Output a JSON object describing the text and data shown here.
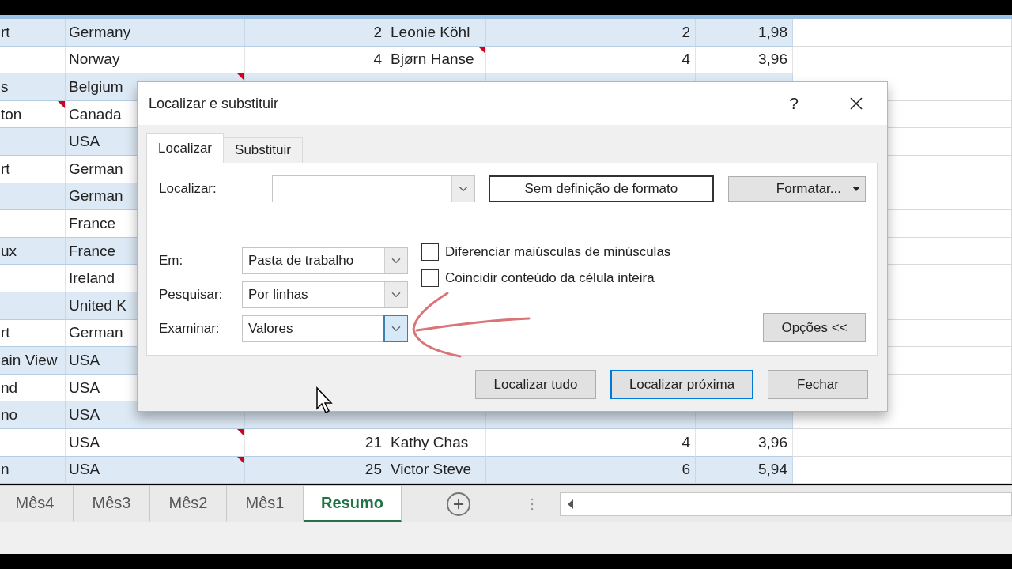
{
  "sheet": {
    "rows": [
      {
        "cells": [
          {
            "text": "rt"
          },
          {
            "text": "Germany"
          },
          {
            "text": "2"
          },
          {
            "text": "Leonie Köhl"
          },
          {
            "text": "2"
          },
          {
            "text": "1,98"
          }
        ]
      },
      {
        "cells": [
          {},
          {
            "text": "Norway"
          },
          {
            "text": "4"
          },
          {
            "text": "Bjørn Hanse",
            "note": true
          },
          {
            "text": "4"
          },
          {
            "text": "3,96"
          }
        ]
      },
      {
        "cells": [
          {
            "text": "s"
          },
          {
            "text": "Belgium",
            "note": true
          },
          {},
          {},
          {},
          {}
        ]
      },
      {
        "cells": [
          {
            "text": "ton",
            "note": true
          },
          {
            "text": "Canada"
          },
          {},
          {},
          {},
          {}
        ]
      },
      {
        "cells": [
          {},
          {
            "text": "USA"
          },
          {},
          {},
          {},
          {}
        ]
      },
      {
        "cells": [
          {
            "text": "rt"
          },
          {
            "text": "German"
          },
          {},
          {},
          {},
          {}
        ]
      },
      {
        "cells": [
          {},
          {
            "text": "German"
          },
          {},
          {},
          {},
          {}
        ]
      },
      {
        "cells": [
          {},
          {
            "text": "France"
          },
          {},
          {},
          {},
          {}
        ]
      },
      {
        "cells": [
          {
            "text": "ux"
          },
          {
            "text": "France"
          },
          {},
          {},
          {},
          {}
        ]
      },
      {
        "cells": [
          {},
          {
            "text": "Ireland"
          },
          {},
          {},
          {},
          {}
        ]
      },
      {
        "cells": [
          {},
          {
            "text": "United K"
          },
          {},
          {},
          {},
          {}
        ]
      },
      {
        "cells": [
          {
            "text": "rt"
          },
          {
            "text": "German"
          },
          {},
          {},
          {},
          {}
        ]
      },
      {
        "cells": [
          {
            "text": "ain View"
          },
          {
            "text": "USA"
          },
          {},
          {},
          {},
          {}
        ]
      },
      {
        "cells": [
          {
            "text": "nd"
          },
          {
            "text": "USA"
          },
          {},
          {},
          {},
          {}
        ]
      },
      {
        "cells": [
          {
            "text": "no"
          },
          {
            "text": "USA"
          },
          {},
          {},
          {},
          {}
        ]
      },
      {
        "cells": [
          {},
          {
            "text": "USA",
            "note": true
          },
          {
            "text": "21"
          },
          {
            "text": "Kathy Chas"
          },
          {
            "text": "4"
          },
          {
            "text": "3,96"
          }
        ]
      },
      {
        "cells": [
          {
            "text": "n"
          },
          {
            "text": "USA",
            "note": true
          },
          {
            "text": "25"
          },
          {
            "text": "Victor Steve"
          },
          {
            "text": "6"
          },
          {
            "text": "5,94"
          }
        ]
      }
    ]
  },
  "dialog": {
    "title": "Localizar e substituir",
    "help_button": "?",
    "tabs": [
      {
        "label": "Localizar",
        "selected": true
      },
      {
        "label": "Substituir",
        "selected": false
      }
    ],
    "find": {
      "label": "Localizar:"
    },
    "format_preview": "Sem definição de formato",
    "format_button": "Formatar...",
    "options": [
      {
        "label": "Em:",
        "value": "Pasta de trabalho",
        "focused": false
      },
      {
        "label": "Pesquisar:",
        "value": "Por linhas",
        "focused": false
      },
      {
        "label": "Examinar:",
        "value": "Valores",
        "focused": true
      }
    ],
    "checkboxes": [
      {
        "label": "Diferenciar maiúsculas de minúsculas",
        "checked": false
      },
      {
        "label": "Coincidir conteúdo da célula inteira",
        "checked": false
      }
    ],
    "options_button": "Opções <<",
    "buttons": [
      {
        "label": "Localizar tudo",
        "default": false
      },
      {
        "label": "Localizar próxima",
        "default": true
      },
      {
        "label": "Fechar",
        "default": false
      }
    ]
  },
  "sheet_tabs": [
    {
      "label": "Mês4",
      "selected": false
    },
    {
      "label": "Mês3",
      "selected": false
    },
    {
      "label": "Mês2",
      "selected": false
    },
    {
      "label": "Mês1",
      "selected": false
    },
    {
      "label": "Resumo",
      "selected": true
    }
  ]
}
